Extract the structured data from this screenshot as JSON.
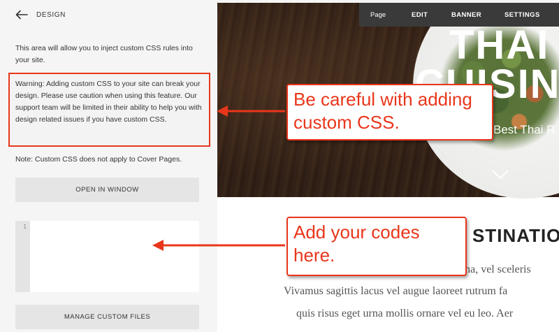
{
  "panel": {
    "back_label": "DESIGN",
    "intro": "This area will allow you to inject custom CSS rules into your site.",
    "warning": "Warning: Adding custom CSS to your site can break your design. Please use caution when using this feature. Our support team will be limited in their ability to help you with design related issues if you have custom CSS.",
    "note": "Note: Custom CSS does not apply to Cover Pages.",
    "open_button": "OPEN IN WINDOW",
    "editor_line_number": "1",
    "manage_button": "MANAGE CUSTOM FILES"
  },
  "toolbar": {
    "page": "Page",
    "edit": "EDIT",
    "banner": "BANNER",
    "settings": "SETTINGS"
  },
  "preview": {
    "hero_title_line1": "THAI",
    "hero_title_line2": "CUISIN",
    "hero_subtitle": "Best Thai R",
    "section_heading": "STINATIO",
    "body_lines": [
      "agna, vel sceleris",
      "Vivamus sagittis lacus vel augue laoreet rutrum fa",
      "quis risus eget urna mollis ornare vel eu leo. Aer"
    ]
  },
  "annotations": {
    "callout_1": [
      "Be careful with adding",
      "custom CSS."
    ],
    "callout_2": [
      "Add your codes",
      "here."
    ],
    "color": "#e9361b"
  },
  "colors": {
    "panel_bg": "#f5f5f5",
    "button_bg": "#e5e5e5",
    "toolbar_bg": "#3a3a3a",
    "accent": "#e9361b"
  }
}
